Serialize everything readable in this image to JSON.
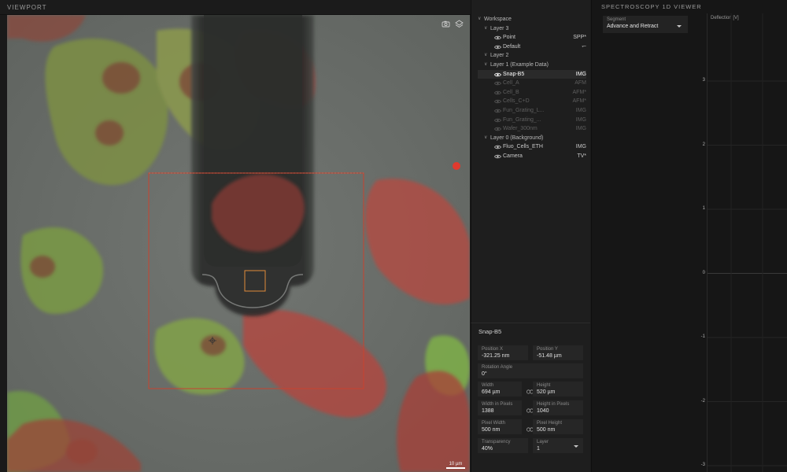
{
  "viewport": {
    "title": "VIEWPORT",
    "icons": [
      "camera-icon",
      "layers-icon"
    ],
    "scalebar_label": "10 µm"
  },
  "tree": {
    "rows": [
      {
        "label": "Workspace",
        "type": "",
        "kind": "group",
        "level": 0,
        "eye": false,
        "state": "normal"
      },
      {
        "label": "Layer 3",
        "type": "",
        "kind": "group",
        "level": 1,
        "eye": false,
        "state": "normal"
      },
      {
        "label": "Point",
        "type": "SPP*",
        "kind": "item",
        "level": 2,
        "eye": true,
        "state": "normal"
      },
      {
        "label": "Default",
        "type": "↽",
        "kind": "item",
        "level": 2,
        "eye": true,
        "state": "normal"
      },
      {
        "label": "Layer 2",
        "type": "",
        "kind": "group",
        "level": 1,
        "eye": false,
        "state": "normal"
      },
      {
        "label": "Layer 1 (Example Data)",
        "type": "",
        "kind": "group",
        "level": 1,
        "eye": false,
        "state": "normal"
      },
      {
        "label": "Snap-B5",
        "type": "IMG",
        "kind": "item",
        "level": 2,
        "eye": true,
        "state": "selected"
      },
      {
        "label": "Cell_A",
        "type": "AFM",
        "kind": "item",
        "level": 2,
        "eye": true,
        "state": "dim"
      },
      {
        "label": "Cell_B",
        "type": "AFM*",
        "kind": "item",
        "level": 2,
        "eye": true,
        "state": "dim"
      },
      {
        "label": "Cells_C+D",
        "type": "AFM*",
        "kind": "item",
        "level": 2,
        "eye": true,
        "state": "dim"
      },
      {
        "label": "Fun_Grating_L...",
        "type": "IMG",
        "kind": "item",
        "level": 2,
        "eye": true,
        "state": "dim"
      },
      {
        "label": "Fun_Grating_...",
        "type": "IMG",
        "kind": "item",
        "level": 2,
        "eye": true,
        "state": "dim"
      },
      {
        "label": "Wafer_300nm",
        "type": "IMG",
        "kind": "item",
        "level": 2,
        "eye": true,
        "state": "dim"
      },
      {
        "label": "Layer 0 (Background)",
        "type": "",
        "kind": "group",
        "level": 1,
        "eye": false,
        "state": "normal"
      },
      {
        "label": "Fluo_Cells_ETH",
        "type": "IMG",
        "kind": "item",
        "level": 2,
        "eye": true,
        "state": "normal"
      },
      {
        "label": "Camera",
        "type": "TV*",
        "kind": "item",
        "level": 2,
        "eye": true,
        "state": "normal"
      }
    ]
  },
  "properties": {
    "title": "Snap-B5",
    "position_x": {
      "label": "Position X",
      "value": "-321.25 nm"
    },
    "position_y": {
      "label": "Position Y",
      "value": "-51.48 µm"
    },
    "rotation": {
      "label": "Rotation Angle",
      "value": "0°"
    },
    "width": {
      "label": "Width",
      "value": "694 µm"
    },
    "height": {
      "label": "Height",
      "value": "520 µm"
    },
    "width_px": {
      "label": "Width in Pixels",
      "value": "1388"
    },
    "height_px": {
      "label": "Height in Pixels",
      "value": "1040"
    },
    "pixel_width": {
      "label": "Pixel Width",
      "value": "500 nm"
    },
    "pixel_height": {
      "label": "Pixel Height",
      "value": "500 nm"
    },
    "transparency": {
      "label": "Transparency",
      "value": "40%"
    },
    "layer": {
      "label": "Layer",
      "value": "1"
    }
  },
  "spectroscopy": {
    "title": "SPECTROSCOPY 1D VIEWER",
    "segment_label": "Segment",
    "segment_value": "Advance and Retract",
    "ylabel": "Deflection [V]",
    "yticks": [
      "3",
      "2",
      "1",
      "0",
      "-1",
      "-2",
      "-3"
    ]
  },
  "colors": {
    "accent_selection": "#d0452f",
    "cell_red": "#b8403a",
    "cell_green": "#86b24a"
  }
}
